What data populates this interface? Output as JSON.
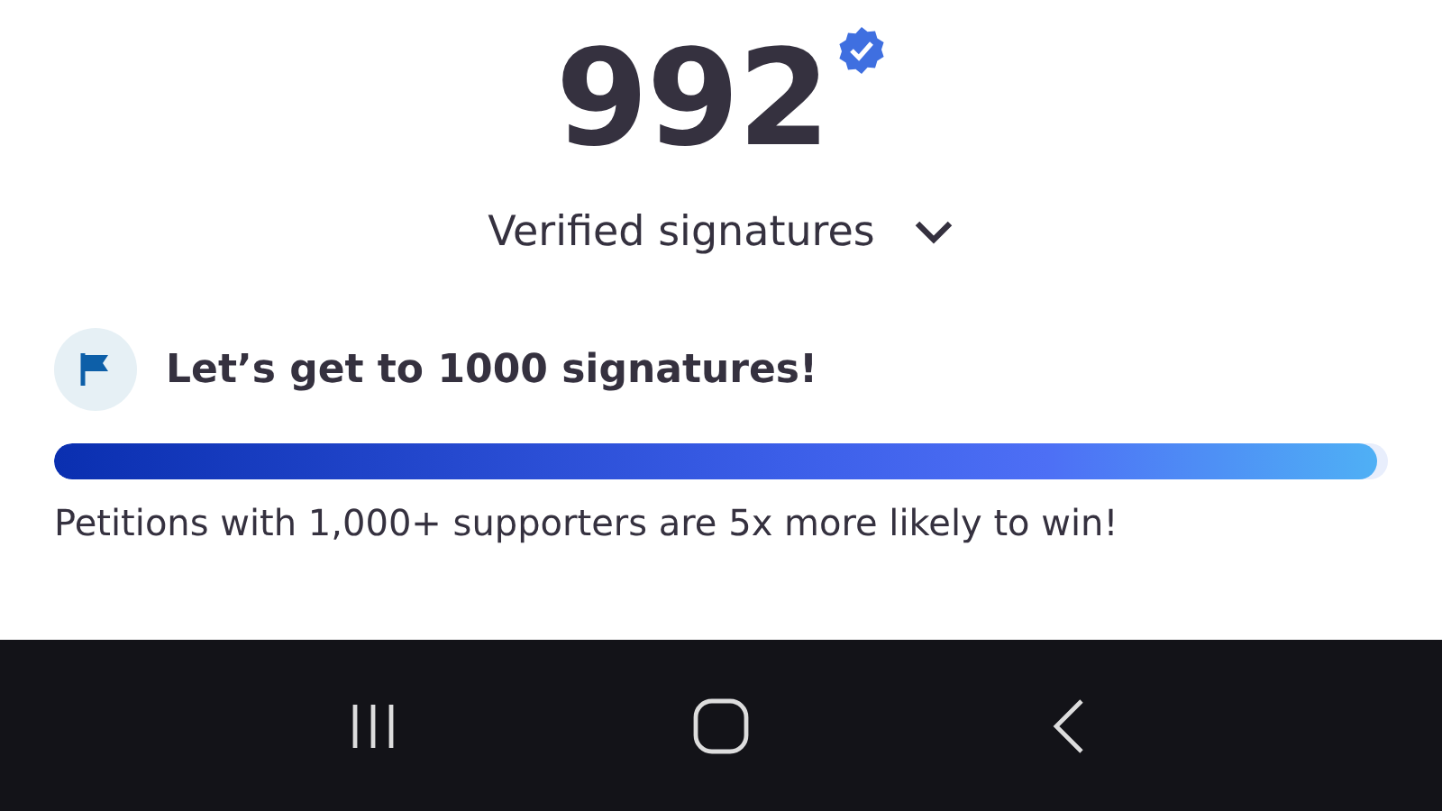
{
  "count": {
    "value": "992",
    "verified": true
  },
  "subtitle": {
    "label": "Verified signatures",
    "expanded": false
  },
  "goal": {
    "title": "Let’s get to 1000 signatures!",
    "level": 0.992
  },
  "note": "Petitions with 1,000+ supporters are 5x more likely to win!",
  "nav_bar": {
    "buttons": [
      {
        "kind": "recents"
      },
      {
        "kind": "home"
      },
      {
        "kind": "back"
      }
    ]
  }
}
